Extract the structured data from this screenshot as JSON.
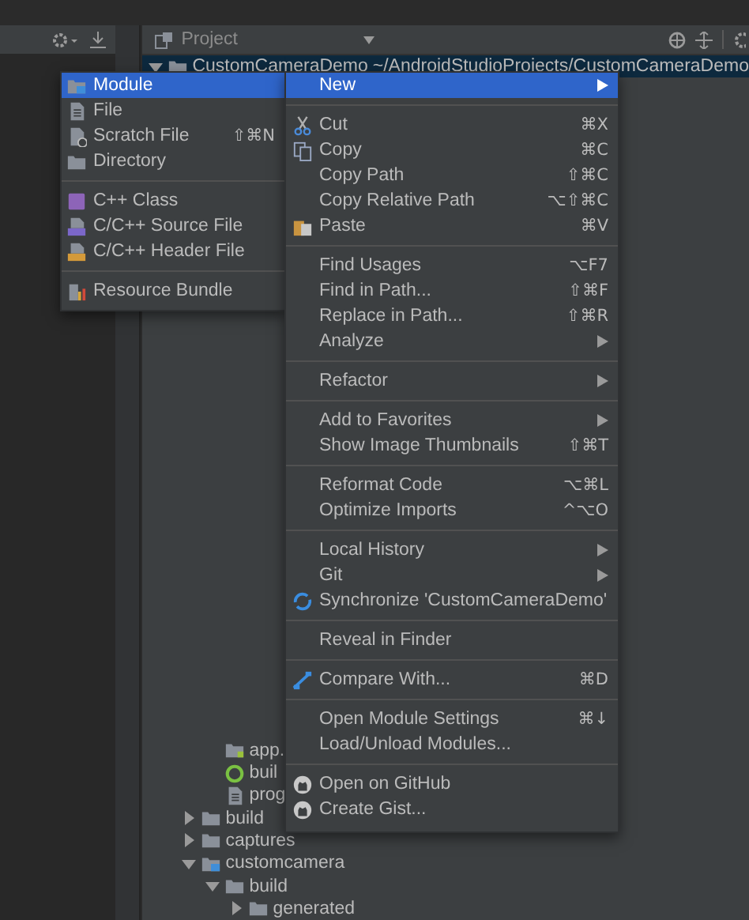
{
  "toolbar": {
    "panel_title": "Project"
  },
  "tree": {
    "label": "CustomCameraDemo",
    "path": "~/AndroidStudioProjects/CustomCameraDemo",
    "expanded": true,
    "selected": true,
    "kind": "folder",
    "children": [
      {
        "kind": "hidden",
        "children": [
          {
            "label": "app.",
            "kind": "module-file"
          },
          {
            "label": "buil",
            "kind": "gradle"
          },
          {
            "label": "prog",
            "kind": "file"
          }
        ]
      },
      {
        "label": "build",
        "kind": "folder",
        "expanded": false
      },
      {
        "label": "captures",
        "kind": "folder",
        "expanded": false
      },
      {
        "label": "customcamera",
        "kind": "module",
        "expanded": true,
        "children": [
          {
            "label": "build",
            "kind": "folder",
            "expanded": true,
            "children": [
              {
                "label": "generated",
                "kind": "folder",
                "expanded": false
              }
            ]
          }
        ]
      }
    ]
  },
  "new_submenu": [
    {
      "kind": "module",
      "label": "Module",
      "selected": true
    },
    {
      "kind": "file",
      "label": "File",
      "selected": false
    },
    {
      "kind": "scratch",
      "label": "Scratch File",
      "shortcut": "⇧⌘N",
      "selected": false
    },
    {
      "kind": "folder",
      "label": "Directory",
      "selected": false
    },
    {
      "kind": "separator"
    },
    {
      "kind": "class",
      "label": "C++ Class",
      "selected": false
    },
    {
      "kind": "source",
      "label": "C/C++ Source File",
      "selected": false
    },
    {
      "kind": "header",
      "label": "C/C++ Header File",
      "selected": false
    },
    {
      "kind": "separator"
    },
    {
      "kind": "bundle",
      "label": "Resource Bundle",
      "selected": false
    }
  ],
  "context_menu": [
    {
      "kind": "plain",
      "label": "New",
      "submenu": true,
      "selected": true
    },
    {
      "kind": "separator"
    },
    {
      "kind": "cut",
      "label": "Cut",
      "shortcut": "⌘X",
      "selected": false
    },
    {
      "kind": "copy",
      "label": "Copy",
      "shortcut": "⌘C",
      "selected": false
    },
    {
      "kind": "plain",
      "label": "Copy Path",
      "shortcut": "⇧⌘C",
      "selected": false
    },
    {
      "kind": "plain",
      "label": "Copy Relative Path",
      "shortcut": "⌥⇧⌘C",
      "selected": false
    },
    {
      "kind": "paste",
      "label": "Paste",
      "shortcut": "⌘V",
      "selected": false
    },
    {
      "kind": "separator"
    },
    {
      "kind": "plain",
      "label": "Find Usages",
      "shortcut": "⌥F7",
      "selected": false
    },
    {
      "kind": "plain",
      "label": "Find in Path...",
      "shortcut": "⇧⌘F",
      "selected": false
    },
    {
      "kind": "plain",
      "label": "Replace in Path...",
      "shortcut": "⇧⌘R",
      "selected": false
    },
    {
      "kind": "plain",
      "label": "Analyze",
      "submenu": true,
      "selected": false
    },
    {
      "kind": "separator"
    },
    {
      "kind": "plain",
      "label": "Refactor",
      "submenu": true,
      "selected": false
    },
    {
      "kind": "separator"
    },
    {
      "kind": "plain",
      "label": "Add to Favorites",
      "submenu": true,
      "selected": false
    },
    {
      "kind": "plain",
      "label": "Show Image Thumbnails",
      "shortcut": "⇧⌘T",
      "selected": false
    },
    {
      "kind": "separator"
    },
    {
      "kind": "plain",
      "label": "Reformat Code",
      "shortcut": "⌥⌘L",
      "selected": false
    },
    {
      "kind": "plain",
      "label": "Optimize Imports",
      "shortcut": "^⌥O",
      "selected": false
    },
    {
      "kind": "separator"
    },
    {
      "kind": "plain",
      "label": "Local History",
      "submenu": true,
      "selected": false
    },
    {
      "kind": "plain",
      "label": "Git",
      "submenu": true,
      "selected": false
    },
    {
      "kind": "sync",
      "label": "Synchronize 'CustomCameraDemo'",
      "selected": false
    },
    {
      "kind": "separator"
    },
    {
      "kind": "plain",
      "label": "Reveal in Finder",
      "selected": false
    },
    {
      "kind": "separator"
    },
    {
      "kind": "compare",
      "label": "Compare With...",
      "shortcut": "⌘D",
      "selected": false
    },
    {
      "kind": "separator"
    },
    {
      "kind": "plain",
      "label": "Open Module Settings",
      "shortcut": "⌘↓",
      "selected": false
    },
    {
      "kind": "plain",
      "label": "Load/Unload Modules...",
      "selected": false
    },
    {
      "kind": "separator"
    },
    {
      "kind": "github",
      "label": "Open on GitHub",
      "selected": false
    },
    {
      "kind": "github",
      "label": "Create Gist...",
      "selected": false
    }
  ]
}
